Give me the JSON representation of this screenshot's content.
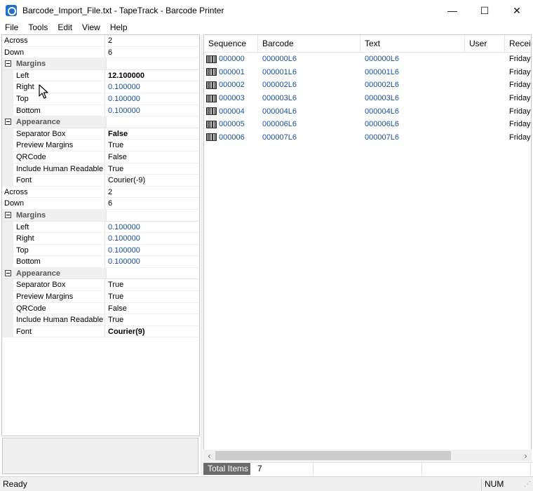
{
  "window": {
    "title": "Barcode_Import_File.txt - TapeTrack - Barcode Printer",
    "minimize": "—",
    "maximize": "☐",
    "close": "✕"
  },
  "menu": [
    "File",
    "Tools",
    "Edit",
    "View",
    "Help"
  ],
  "properties": {
    "group1": {
      "across_label": "Across",
      "across_value": "2",
      "down_label": "Down",
      "down_value": "6",
      "margins_label": "Margins",
      "left_label": "Left",
      "left_value": "12.100000",
      "right_label": "Right",
      "right_value": "0.100000",
      "top_label": "Top",
      "top_value": "0.100000",
      "bottom_label": "Bottom",
      "bottom_value": "0.100000",
      "appearance_label": "Appearance",
      "separator_label": "Separator Box",
      "separator_value": "False",
      "preview_label": "Preview Margins",
      "preview_value": "True",
      "qrcode_label": "QRCode",
      "qrcode_value": "False",
      "human_label": "Include Human Readable",
      "human_value": "True",
      "font_label": "Font",
      "font_value": "Courier(-9)"
    },
    "group2": {
      "across_label": "Across",
      "across_value": "2",
      "down_label": "Down",
      "down_value": "6",
      "margins_label": "Margins",
      "left_label": "Left",
      "left_value": "0.100000",
      "right_label": "Right",
      "right_value": "0.100000",
      "top_label": "Top",
      "top_value": "0.100000",
      "bottom_label": "Bottom",
      "bottom_value": "0.100000",
      "appearance_label": "Appearance",
      "separator_label": "Separator Box",
      "separator_value": "True",
      "preview_label": "Preview Margins",
      "preview_value": "True",
      "qrcode_label": "QRCode",
      "qrcode_value": "False",
      "human_label": "Include Human Readable",
      "human_value": "True",
      "font_label": "Font",
      "font_value": "Courier(9)"
    }
  },
  "list": {
    "columns": [
      "Sequence",
      "Barcode",
      "Text",
      "User",
      "Received"
    ],
    "rows": [
      {
        "sequence": "000000",
        "barcode": "000000L6",
        "text": "000000L6",
        "user": "",
        "received": "Friday"
      },
      {
        "sequence": "000001",
        "barcode": "000001L6",
        "text": "000001L6",
        "user": "",
        "received": "Friday"
      },
      {
        "sequence": "000002",
        "barcode": "000002L6",
        "text": "000002L6",
        "user": "",
        "received": "Friday"
      },
      {
        "sequence": "000003",
        "barcode": "000003L6",
        "text": "000003L6",
        "user": "",
        "received": "Friday"
      },
      {
        "sequence": "000004",
        "barcode": "000004L6",
        "text": "000004L6",
        "user": "",
        "received": "Friday"
      },
      {
        "sequence": "000005",
        "barcode": "000006L6",
        "text": "000006L6",
        "user": "",
        "received": "Friday"
      },
      {
        "sequence": "000006",
        "barcode": "000007L6",
        "text": "000007L6",
        "user": "",
        "received": "Friday"
      }
    ]
  },
  "info": {
    "total_label": "Total Items",
    "total_value": "7"
  },
  "status": {
    "text": "Ready",
    "num": "NUM"
  },
  "icons": {
    "app": "barcode-printer-app-icon",
    "row": "barcode-icon",
    "scroll_left": "‹",
    "scroll_right": "›"
  }
}
